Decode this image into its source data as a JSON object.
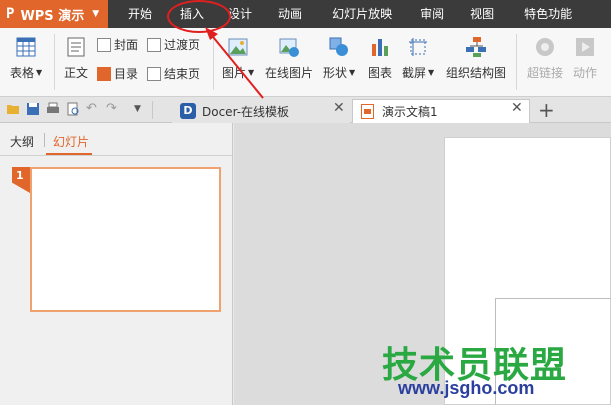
{
  "app": {
    "name": "WPS 演示",
    "logo_letter": "P"
  },
  "menu": [
    "开始",
    "插入",
    "设计",
    "动画",
    "幻灯片放映",
    "审阅",
    "视图",
    "特色功能"
  ],
  "ribbon": {
    "table": "表格",
    "body_text": "正文",
    "cover": "封面",
    "toc": "目录",
    "transition_page": "过渡页",
    "end_page": "结束页",
    "picture": "图片",
    "online_picture": "在线图片",
    "shape": "形状",
    "chart": "图表",
    "screenshot": "截屏",
    "org_chart": "组织结构图",
    "hyperlink": "超链接",
    "action": "动作"
  },
  "tabs": [
    {
      "label": "Docer-在线模板",
      "active": false
    },
    {
      "label": "演示文稿1",
      "active": true
    }
  ],
  "panel": {
    "outline_tab": "大纲",
    "slides_tab": "幻灯片",
    "slide_number": "1"
  },
  "watermark": {
    "cn": "技术员联盟",
    "url": "www.jsgho.com"
  },
  "colors": {
    "accent": "#e0662b",
    "menubar": "#3b3b3b",
    "annotation": "#e02020"
  },
  "icons": [
    "table-icon",
    "body-text-icon",
    "cover-icon",
    "toc-icon",
    "transition-icon",
    "end-icon",
    "picture-icon",
    "online-picture-icon",
    "shape-icon",
    "chart-icon",
    "screenshot-icon",
    "org-chart-icon",
    "hyperlink-icon",
    "action-icon",
    "open-icon",
    "save-icon",
    "print-icon",
    "preview-icon",
    "undo-icon",
    "redo-icon",
    "docer-icon",
    "presentation-icon",
    "close-icon",
    "plus-icon"
  ]
}
